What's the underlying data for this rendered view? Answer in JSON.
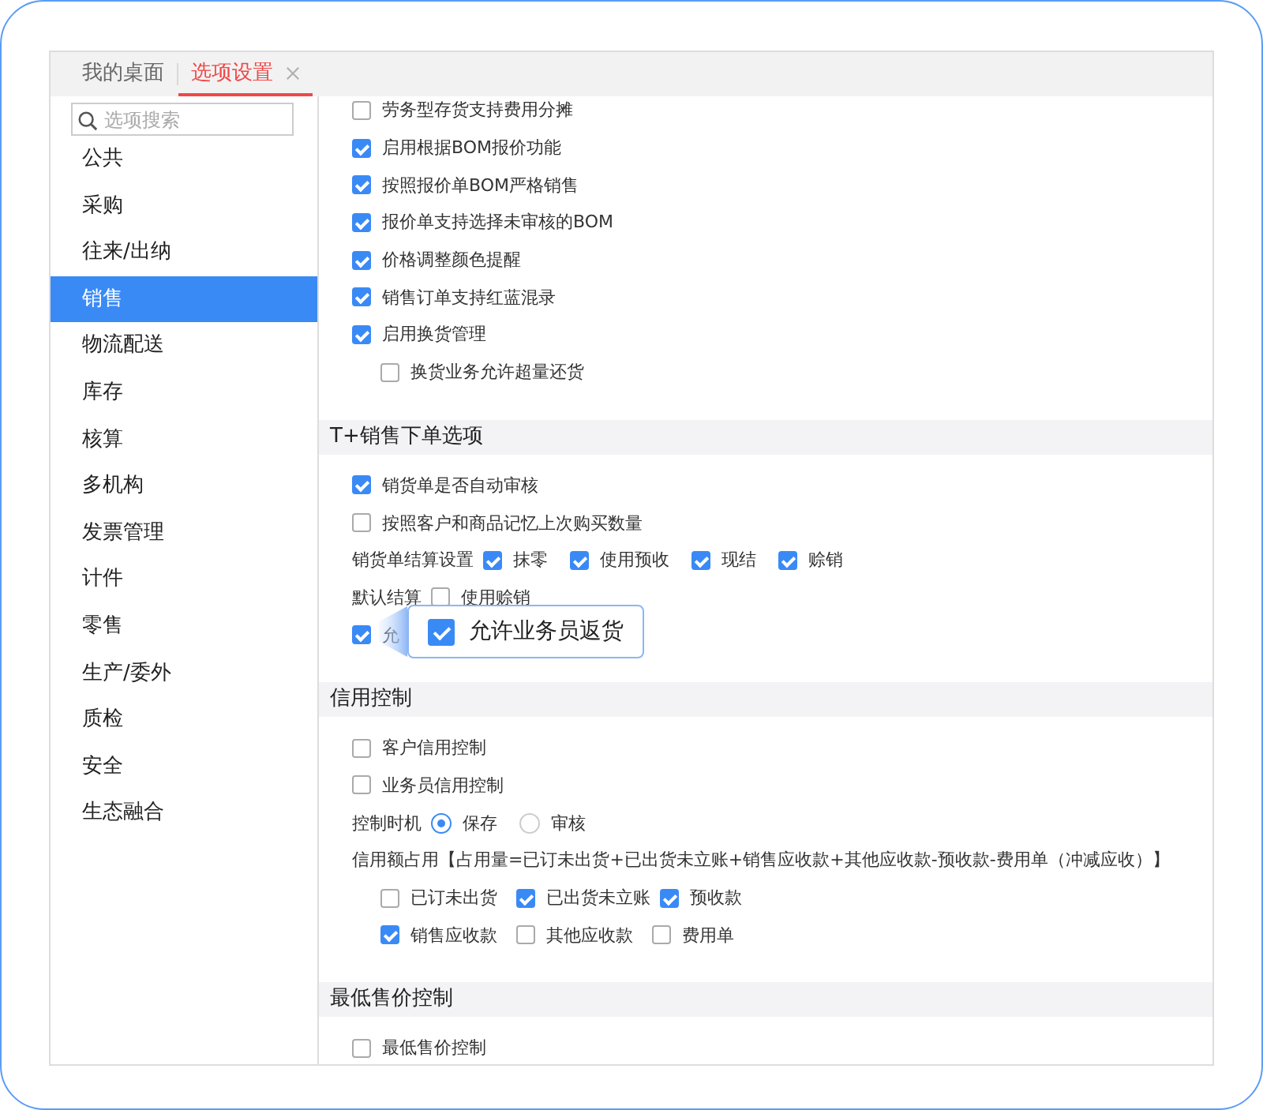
{
  "tabs": [
    {
      "label": "我的桌面",
      "selected": false,
      "closable": false
    },
    {
      "label": "选项设置",
      "selected": true,
      "closable": true
    }
  ],
  "search": {
    "placeholder": "选项搜索"
  },
  "sidebar": {
    "items": [
      {
        "label": "公共",
        "selected": false
      },
      {
        "label": "采购",
        "selected": false
      },
      {
        "label": "往来/出纳",
        "selected": false
      },
      {
        "label": "销售",
        "selected": true
      },
      {
        "label": "物流配送",
        "selected": false
      },
      {
        "label": "库存",
        "selected": false
      },
      {
        "label": "核算",
        "selected": false
      },
      {
        "label": "多机构",
        "selected": false
      },
      {
        "label": "发票管理",
        "selected": false
      },
      {
        "label": "计件",
        "selected": false
      },
      {
        "label": "零售",
        "selected": false
      },
      {
        "label": "生产/委外",
        "selected": false
      },
      {
        "label": "质检",
        "selected": false
      },
      {
        "label": "安全",
        "selected": false
      },
      {
        "label": "生态融合",
        "selected": false
      }
    ]
  },
  "sections": [
    {
      "rows": [
        {
          "kind": "checkbox",
          "label": "劳务型存货支持费用分摊",
          "checked": false
        },
        {
          "kind": "checkbox",
          "label": "启用根据BOM报价功能",
          "checked": true
        },
        {
          "kind": "checkbox",
          "label": "按照报价单BOM严格销售",
          "checked": true
        },
        {
          "kind": "checkbox",
          "label": "报价单支持选择未审核的BOM",
          "checked": true
        },
        {
          "kind": "checkbox",
          "label": "价格调整颜色提醒",
          "checked": true
        },
        {
          "kind": "checkbox",
          "label": "销售订单支持红蓝混录",
          "checked": true
        },
        {
          "kind": "checkbox",
          "label": "启用换货管理",
          "checked": true,
          "children": [
            {
              "kind": "checkbox",
              "label": "换货业务允许超量还货",
              "checked": false
            }
          ]
        }
      ]
    },
    {
      "title": "T+销售下单选项",
      "rows": [
        {
          "kind": "checkbox",
          "label": "销货单是否自动审核",
          "checked": true
        },
        {
          "kind": "checkbox",
          "label": "按照客户和商品记忆上次购买数量",
          "checked": false
        },
        {
          "kind": "checkgroup",
          "label": "销货单结算设置",
          "options": [
            {
              "label": "抹零",
              "checked": true
            },
            {
              "label": "使用预收",
              "checked": true
            },
            {
              "label": "现结",
              "checked": true
            },
            {
              "label": "赊销",
              "checked": true
            }
          ]
        },
        {
          "kind": "checkgroup",
          "label": "默认结算",
          "options": [
            {
              "label": "使用赊销",
              "checked": false
            }
          ]
        },
        {
          "kind": "checkbox",
          "label": "允",
          "checked": true
        }
      ]
    },
    {
      "title": "信用控制",
      "rows": [
        {
          "kind": "checkbox",
          "label": "客户信用控制",
          "checked": false
        },
        {
          "kind": "checkbox",
          "label": "业务员信用控制",
          "checked": false
        },
        {
          "kind": "radiogroup",
          "label": "控制时机",
          "options": [
            {
              "label": "保存",
              "selected": true
            },
            {
              "label": "审核",
              "selected": false
            }
          ]
        },
        {
          "kind": "text",
          "label": "信用额占用【占用量=已订未出货+已出货未立账+销售应收款+其他应收款-预收款-费用单（冲减应收）】",
          "children": [
            {
              "kind": "checkgroup",
              "options": [
                {
                  "label": "已订未出货",
                  "checked": false
                },
                {
                  "label": "已出货未立账",
                  "checked": true
                },
                {
                  "label": "预收款",
                  "checked": true
                }
              ]
            },
            {
              "kind": "checkgroup",
              "options": [
                {
                  "label": "销售应收款",
                  "checked": true
                },
                {
                  "label": "其他应收款",
                  "checked": false
                },
                {
                  "label": "费用单",
                  "checked": false
                }
              ]
            }
          ]
        }
      ]
    },
    {
      "title": "最低售价控制",
      "rows": [
        {
          "kind": "checkbox",
          "label": "最低售价控制",
          "checked": false
        }
      ]
    }
  ],
  "callout": {
    "label": "允许业务员返货",
    "checked": true
  }
}
